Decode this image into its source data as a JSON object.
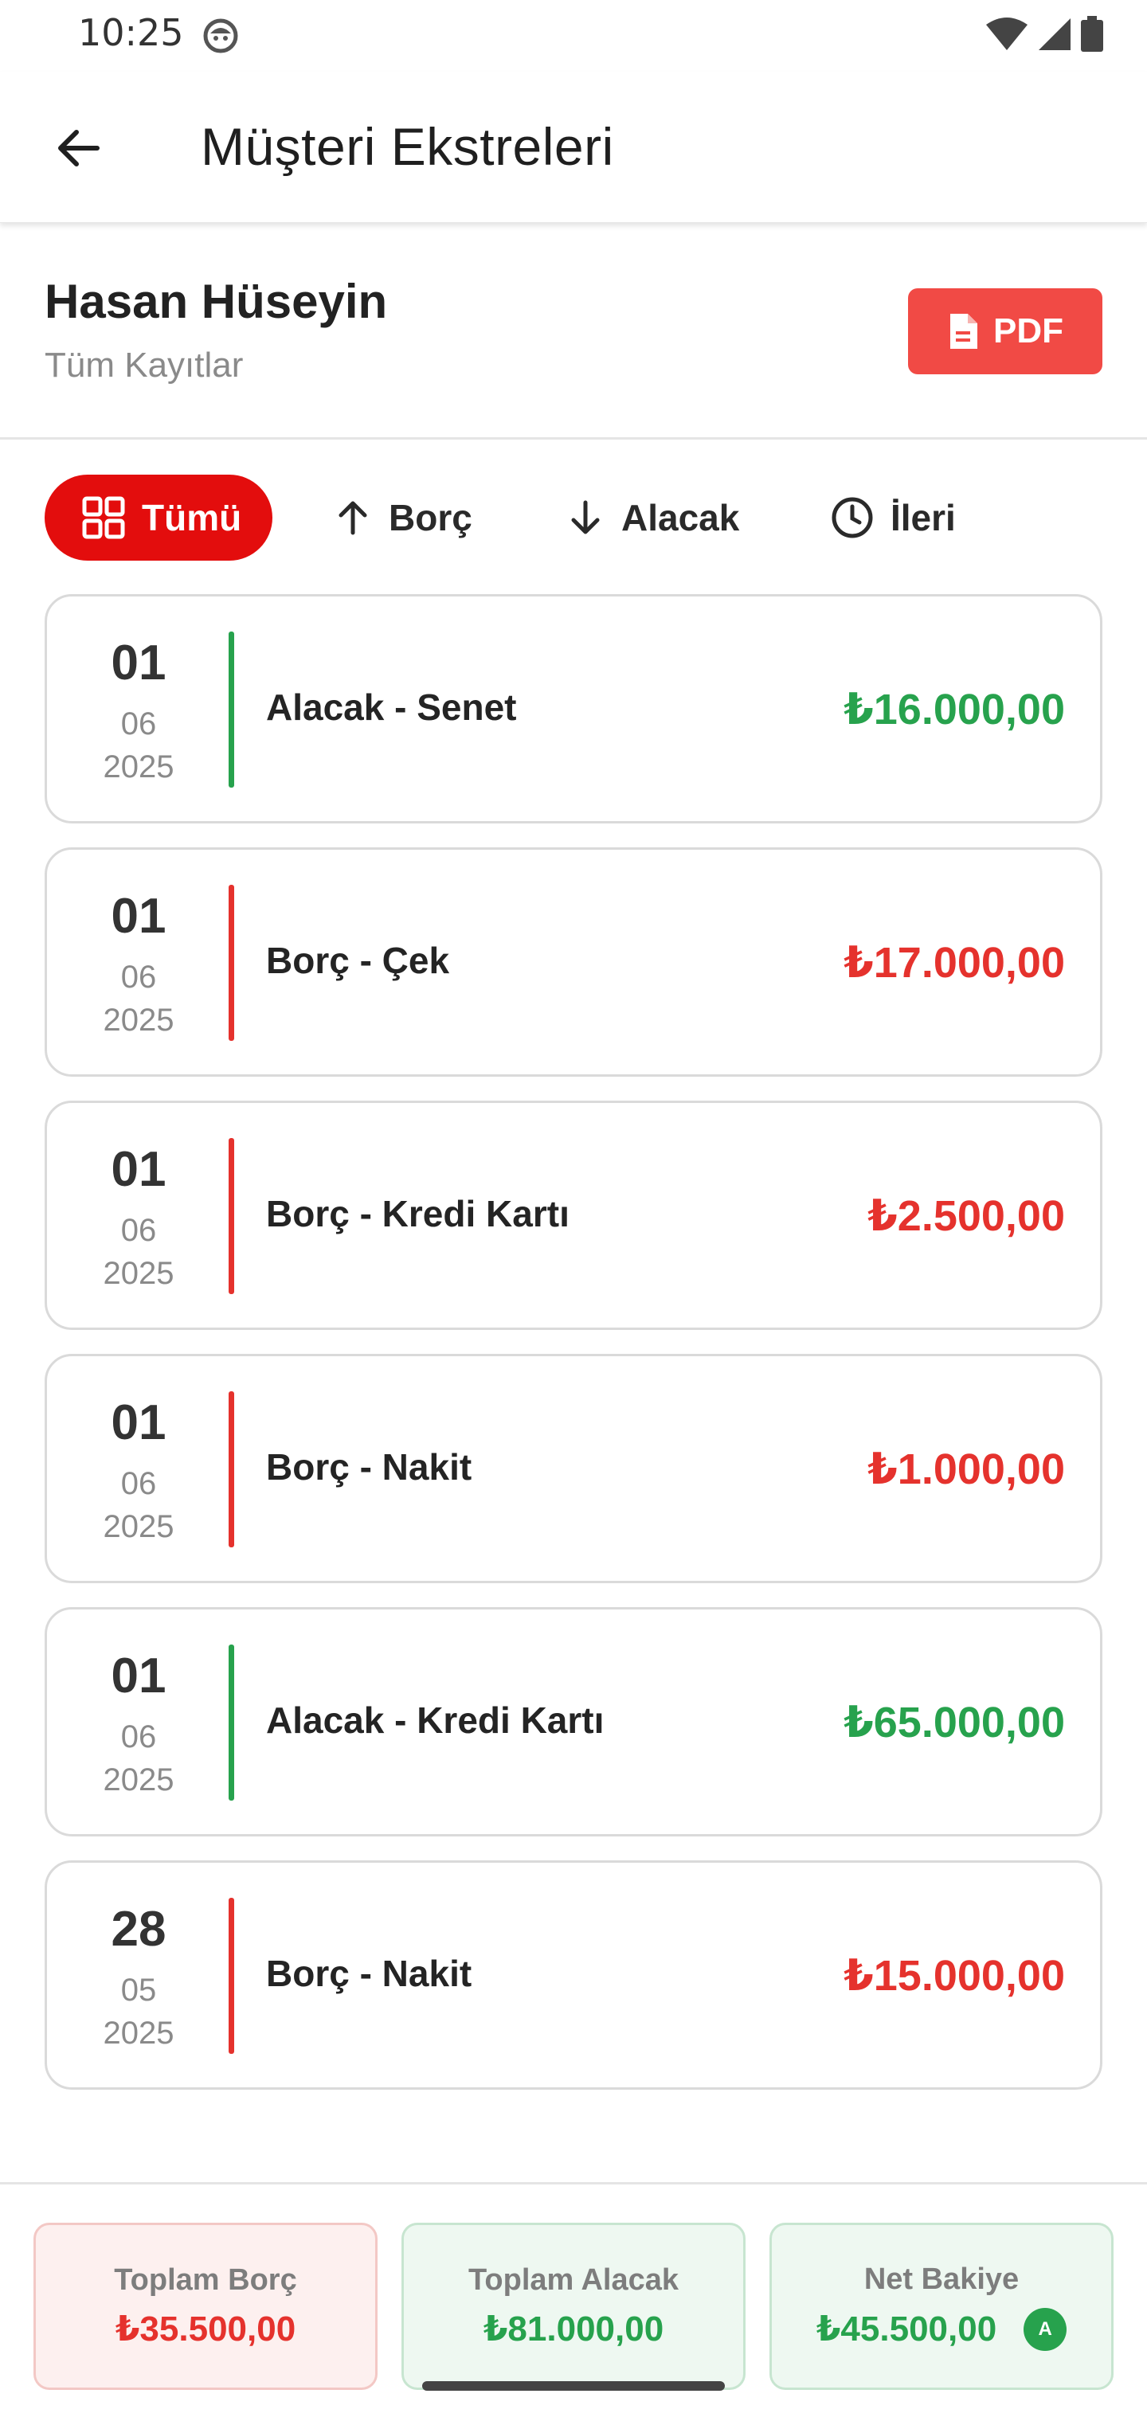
{
  "status_bar": {
    "time": "10:25"
  },
  "app_bar": {
    "title": "Müşteri Ekstreleri"
  },
  "customer": {
    "name": "Hasan Hüseyin",
    "subtitle": "Tüm Kayıtlar",
    "pdf_label": "PDF"
  },
  "filters": {
    "all": "Tümü",
    "debt": "Borç",
    "credit": "Alacak",
    "forward": "İleri",
    "selected": "Tümü"
  },
  "transactions": [
    {
      "day": "01",
      "month": "06",
      "year": "2025",
      "description": "Alacak - Senet",
      "amount": "₺16.000,00",
      "type": "credit"
    },
    {
      "day": "01",
      "month": "06",
      "year": "2025",
      "description": "Borç - Çek",
      "amount": "₺17.000,00",
      "type": "debt"
    },
    {
      "day": "01",
      "month": "06",
      "year": "2025",
      "description": "Borç - Kredi Kartı",
      "amount": "₺2.500,00",
      "type": "debt"
    },
    {
      "day": "01",
      "month": "06",
      "year": "2025",
      "description": "Borç - Nakit",
      "amount": "₺1.000,00",
      "type": "debt"
    },
    {
      "day": "01",
      "month": "06",
      "year": "2025",
      "description": "Alacak - Kredi Kartı",
      "amount": "₺65.000,00",
      "type": "credit"
    },
    {
      "day": "28",
      "month": "05",
      "year": "2025",
      "description": "Borç - Nakit",
      "amount": "₺15.000,00",
      "type": "debt"
    }
  ],
  "summary": {
    "total_debt_label": "Toplam Borç",
    "total_debt": "₺35.500,00",
    "total_credit_label": "Toplam Alacak",
    "total_credit": "₺81.000,00",
    "net_balance_label": "Net Bakiye",
    "net_balance": "₺45.500,00",
    "net_badge": "A"
  },
  "colors": {
    "accent_red": "#e30d0d",
    "pdf_red": "#f14a45",
    "credit_green": "#27a24d",
    "debt_red": "#e5322d"
  },
  "icons": [
    "back-arrow-icon",
    "pdf-document-icon",
    "grid-icon",
    "arrow-up-icon",
    "arrow-down-icon",
    "clock-icon",
    "wifi-icon",
    "cellular-icon",
    "battery-icon",
    "notification-icon"
  ]
}
